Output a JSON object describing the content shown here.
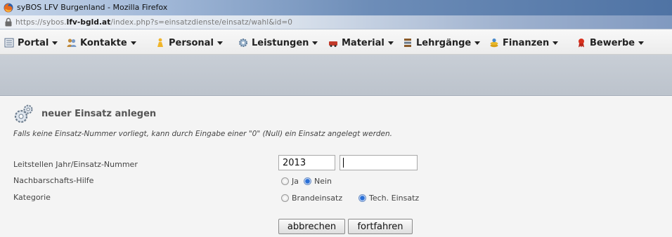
{
  "window": {
    "title": "syBOS LFV Burgenland - Mozilla Firefox"
  },
  "urlbar": {
    "prefix": "https://sybos.",
    "domain": "lfv-bgld.at",
    "path": "/index.php?s=einsatzdienste/einsatz/wahl&id=0"
  },
  "menu": {
    "items": [
      {
        "label": "Portal",
        "icon": "portal-icon",
        "color": "#5b6f8c"
      },
      {
        "label": "Kontakte",
        "icon": "contacts-icon",
        "color": "#c08a3a"
      },
      {
        "label": "Personal",
        "icon": "personal-icon",
        "color": "#e0a020"
      },
      {
        "label": "Leistungen",
        "icon": "gear-icon",
        "color": "#7a9bb8"
      },
      {
        "label": "Material",
        "icon": "material-icon",
        "color": "#c23a2a"
      },
      {
        "label": "Lehrgänge",
        "icon": "books-icon",
        "color": "#8a5a2a"
      },
      {
        "label": "Finanzen",
        "icon": "money-icon",
        "color": "#d8a018"
      },
      {
        "label": "Bewerbe",
        "icon": "ribbon-icon",
        "color": "#d8301e"
      }
    ]
  },
  "page": {
    "heading": "neuer Einsatz anlegen",
    "hint": "Falls keine Einsatz-Nummer vorliegt, kann durch Eingabe einer \"0\" (Null) ein Einsatz angelegt werden.",
    "fields": {
      "jahr_label": "Leitstellen Jahr/Einsatz-Nummer",
      "jahr_value": "2013",
      "nummer_value": "",
      "nachbar_label": "Nachbarschafts-Hilfe",
      "nachbar_options": [
        "Ja",
        "Nein"
      ],
      "nachbar_selected": "Nein",
      "kategorie_label": "Kategorie",
      "kategorie_options": [
        "Brandeinsatz",
        "Tech. Einsatz"
      ],
      "kategorie_selected": "Tech. Einsatz"
    },
    "buttons": {
      "cancel": "abbrechen",
      "continue": "fortfahren"
    }
  }
}
